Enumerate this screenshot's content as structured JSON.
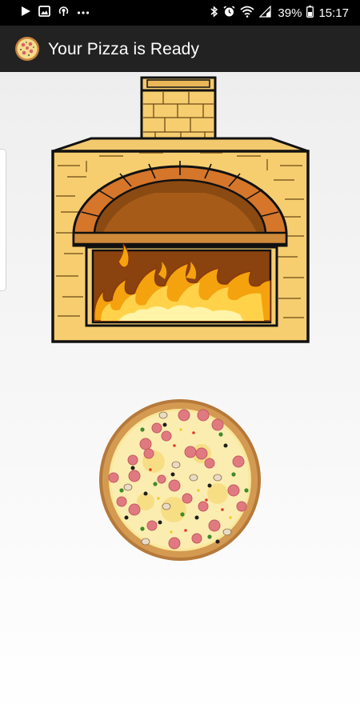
{
  "status_bar": {
    "left_icons": [
      "play-store-icon",
      "gallery-icon",
      "hotspot-icon",
      "more-dots-icon"
    ],
    "right_icons": [
      "bluetooth-icon",
      "alarm-icon",
      "wifi-icon",
      "signal-icon",
      "battery-icon"
    ],
    "battery_percent": "39%",
    "time": "15:17"
  },
  "app_bar": {
    "title": "Your Pizza is Ready",
    "icon": "pizza-icon"
  },
  "main": {
    "oven": "brick-pizza-oven-illustration",
    "pizza": "pepperoni-pizza-illustration"
  },
  "colors": {
    "status_bar_bg": "#000000",
    "app_bar_bg": "#222222",
    "brick": "#F6CE70",
    "arch": "#D5762A",
    "fire": "#F5A20F",
    "pizza_cheese": "#F9E79A",
    "pepperoni": "#E07A80"
  }
}
